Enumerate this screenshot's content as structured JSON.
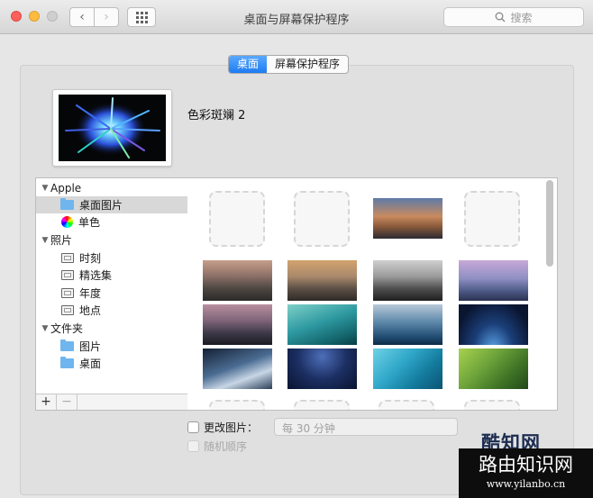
{
  "window": {
    "title": "桌面与屏幕保护程序"
  },
  "toolbar": {
    "back": "‹",
    "forward": "›",
    "search_placeholder": "搜索"
  },
  "tabs": [
    {
      "label": "桌面",
      "selected": true
    },
    {
      "label": "屏幕保护程序",
      "selected": false
    }
  ],
  "current_wallpaper": {
    "name": "色彩斑斓 2"
  },
  "sidebar": {
    "groups": [
      {
        "label": "Apple",
        "items": [
          {
            "label": "桌面图片",
            "icon": "folder-icon",
            "selected": true
          },
          {
            "label": "单色",
            "icon": "color-wheel-icon"
          }
        ]
      },
      {
        "label": "照片",
        "items": [
          {
            "label": "时刻",
            "icon": "album-icon"
          },
          {
            "label": "精选集",
            "icon": "album-icon"
          },
          {
            "label": "年度",
            "icon": "album-icon"
          },
          {
            "label": "地点",
            "icon": "album-icon"
          }
        ]
      },
      {
        "label": "文件夹",
        "items": [
          {
            "label": "图片",
            "icon": "folder-icon"
          },
          {
            "label": "桌面",
            "icon": "folder-icon"
          }
        ]
      }
    ],
    "add_label": "+",
    "remove_label": "−"
  },
  "options": {
    "change_picture_label": "更改图片：",
    "interval": "每 30 分钟",
    "random_order_label": "随机顺序"
  },
  "watermark": {
    "line1": "酷知网",
    "line2": "路由知识网",
    "line3": "www.yilanbo.cn"
  },
  "colors": {
    "accent": "#1e7cf2",
    "folder": "#6fb6ee"
  }
}
